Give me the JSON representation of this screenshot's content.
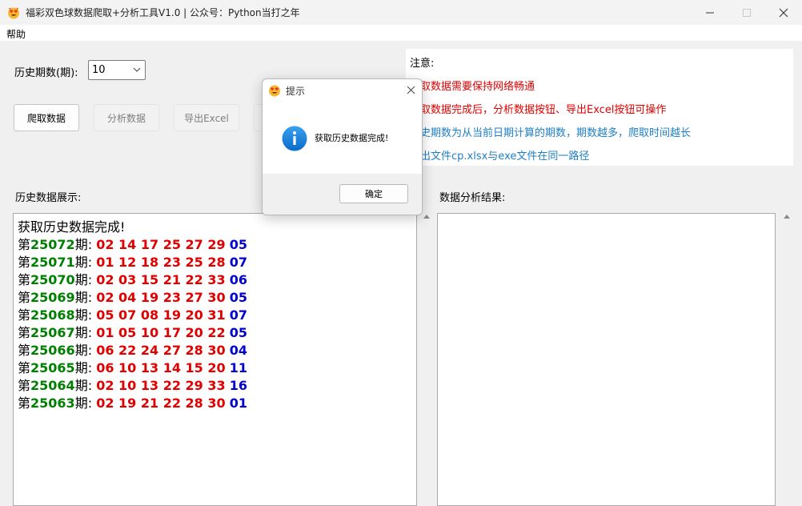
{
  "window": {
    "title": "福彩双色球数据爬取+分析工具V1.0 | 公众号：Python当打之年",
    "app_icon": "heart-eyes-emoji-icon",
    "controls": [
      "minimize-icon",
      "maximize-icon",
      "close-icon"
    ]
  },
  "menu": {
    "help": "帮助"
  },
  "controls": {
    "period_label": "历史期数(期):",
    "period_value": "10",
    "crawl_button": "爬取数据",
    "analyze_button": "分析数据",
    "export_button": "导出Excel"
  },
  "notice": {
    "title": "注意:",
    "lines": [
      {
        "text": "爬取数据需要保持网络畅通",
        "color": "#e00000"
      },
      {
        "text": "爬取数据完成后，分析数据按钮、导出Excel按钮可操作",
        "color": "#e00000"
      },
      {
        "text": "历史期数为从当前日期计算的期数，期数越多，爬取时间越长",
        "color": "#1e7fc4"
      },
      {
        "text": "导出文件cp.xlsx与exe文件在同一路径",
        "color": "#1e7fc4"
      }
    ]
  },
  "history": {
    "label": "历史数据展示:",
    "header": "获取历史数据完成!",
    "prefix": "第",
    "suffix": "期:",
    "rows": [
      {
        "issue": "25072",
        "red": "02 14 17 25 27 29",
        "blue": "05"
      },
      {
        "issue": "25071",
        "red": "01 12 18 23 25 28",
        "blue": "07"
      },
      {
        "issue": "25070",
        "red": "02 03 15 21 22 33",
        "blue": "06"
      },
      {
        "issue": "25069",
        "red": "02 04 19 23 27 30",
        "blue": "05"
      },
      {
        "issue": "25068",
        "red": "05 07 08 19 20 31",
        "blue": "07"
      },
      {
        "issue": "25067",
        "red": "01 05 10 17 20 22",
        "blue": "05"
      },
      {
        "issue": "25066",
        "red": "06 22 24 27 28 30",
        "blue": "04"
      },
      {
        "issue": "25065",
        "red": "06 10 13 14 15 20",
        "blue": "11"
      },
      {
        "issue": "25064",
        "red": "02 10 13 22 29 33",
        "blue": "16"
      },
      {
        "issue": "25063",
        "red": "02 19 21 22 28 30",
        "blue": "01"
      }
    ]
  },
  "analysis": {
    "label": "数据分析结果:"
  },
  "dialog": {
    "title": "提示",
    "message": "获取历史数据完成!",
    "ok": "确定",
    "icon": "info-icon"
  },
  "colors": {
    "issue": "#008000",
    "red_ball": "#e00000",
    "blue_ball": "#0000d0",
    "info_blue": "#1e7fc4"
  }
}
